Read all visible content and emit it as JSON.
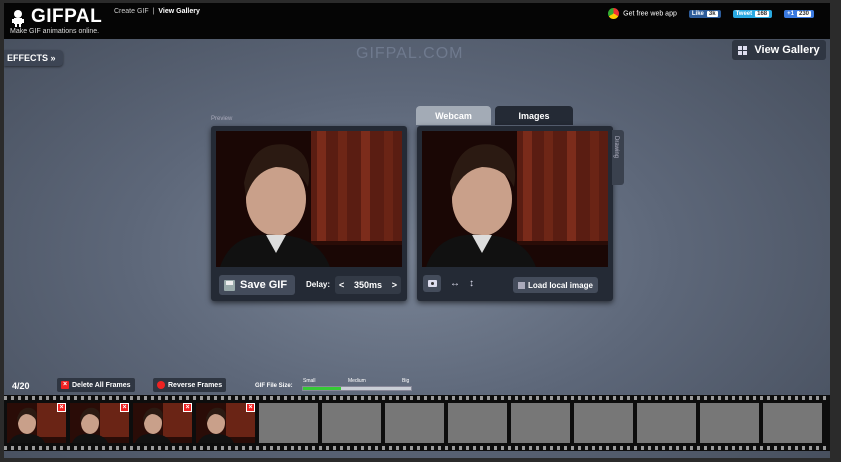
{
  "header": {
    "app_name": "GIFPAL",
    "tagline": "Make GIF animations online.",
    "nav": [
      {
        "label": "Create GIF"
      },
      {
        "label": "View Gallery"
      }
    ],
    "nav_separator": "|",
    "get_app_label": "Get free web app",
    "social": [
      {
        "name": "Like",
        "count": "3k"
      },
      {
        "name": "Tweet",
        "count": "168"
      },
      {
        "name": "+1",
        "count": "230"
      }
    ]
  },
  "effects_tab": {
    "label": "EFFECTS »"
  },
  "watermark": "GIFPAL.COM",
  "view_gallery_button": {
    "label": "View Gallery"
  },
  "preview": {
    "label": "Preview",
    "save_label": "Save GIF",
    "delay_label": "Delay:",
    "delay_value": "350ms",
    "prev_arrow": "<",
    "next_arrow": ">"
  },
  "capture": {
    "tabs": [
      {
        "label": "Webcam",
        "active": false
      },
      {
        "label": "Images",
        "active": true
      }
    ],
    "drawing_tab": "Drawing",
    "flip_h": "↔",
    "flip_v": "↕",
    "load_label": "Load local image"
  },
  "bottom": {
    "frame_count": "4/20",
    "delete_all_label": "Delete All Frames",
    "reverse_label": "Reverse Frames",
    "file_size_label": "GIF File Size:",
    "size_levels": [
      "Small",
      "Medium",
      "Big"
    ],
    "size_fill": 0.35
  },
  "filmstrip": {
    "total_slots": 13,
    "frames_filled": 4,
    "delete_glyph": "×"
  },
  "colors": {
    "accent_green": "#36c936",
    "delete_red": "#e22222",
    "panel": "#242a35"
  }
}
